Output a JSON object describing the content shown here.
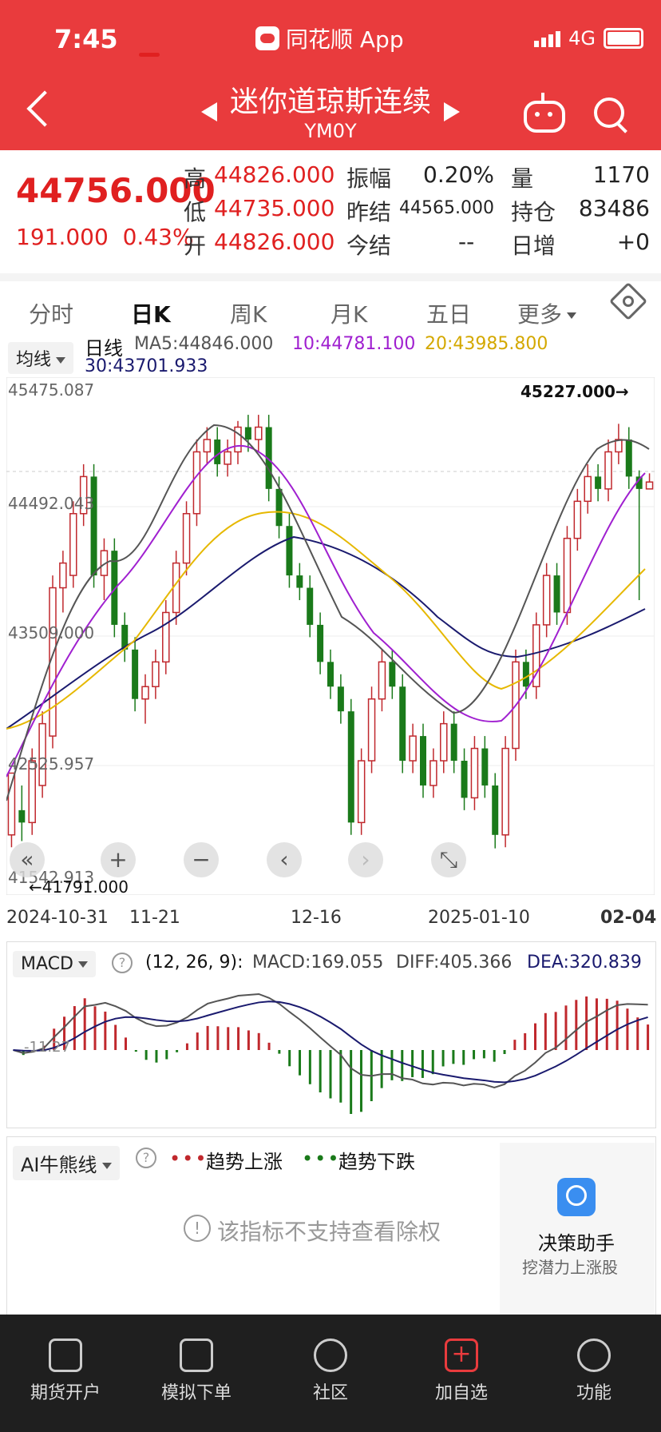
{
  "status": {
    "time": "7:45",
    "app": "同花顺 App",
    "network": "4G"
  },
  "header": {
    "title": "迷你道琼斯连续",
    "symbol": "YM0Y"
  },
  "quote": {
    "price": "44756.000",
    "change": "191.000",
    "change_pct": "0.43%",
    "high_label": "高",
    "high": "44826.000",
    "low_label": "低",
    "low": "44735.000",
    "open_label": "开",
    "open": "44826.000",
    "amp_label": "振幅",
    "amp": "0.20%",
    "prev_label": "昨结",
    "prev": "44565.000",
    "today_label": "今结",
    "today": "--",
    "vol_label": "量",
    "vol": "1170",
    "oi_label": "持仓",
    "oi": "83486",
    "daily_label": "日增",
    "daily": "+0"
  },
  "tabs": [
    "分时",
    "日K",
    "周K",
    "月K",
    "五日",
    "更多"
  ],
  "legend": {
    "select": "均线",
    "period": "日线",
    "ma5": "MA5:44846.000",
    "ma10": "10:44781.100",
    "ma20": "20:43985.800",
    "ma30": "30:43701.933",
    "colors": {
      "ma5": "#555555",
      "ma10": "#a020d0",
      "ma20": "#e6b800",
      "ma30": "#1a1a6e",
      "up": "#c0282d",
      "down": "#1a7a1a"
    }
  },
  "price_axis": [
    "45475.087",
    "44492.043",
    "43509.000",
    "42525.957",
    "41542.913"
  ],
  "annotations": {
    "max": "45227.000→",
    "min": "←41791.000"
  },
  "dates": [
    "2024-10-31",
    "11-21",
    "12-16",
    "2025-01-10",
    "02-04"
  ],
  "macd": {
    "select": "MACD",
    "params": "(12, 26, 9):",
    "macd": "MACD:169.055",
    "diff": "DIFF:405.366",
    "dea": "DEA:320.839",
    "axis_label": "-11.27"
  },
  "ai": {
    "select": "AI牛熊线",
    "up": "趋势上涨",
    "down": "趋势下跌",
    "notice": "该指标不支持查看除权",
    "helper_title": "决策助手",
    "helper_sub": "挖潜力上涨股"
  },
  "nav": [
    "期货开户",
    "模拟下单",
    "社区",
    "加自选",
    "功能"
  ],
  "chart_data": {
    "type": "candlestick",
    "ylim": [
      41542.913,
      45475.087
    ],
    "candles": [
      [
        41900,
        42400,
        41800,
        42100
      ],
      [
        42100,
        42000,
        41850,
        42300
      ],
      [
        42000,
        42500,
        41900,
        42600
      ],
      [
        42300,
        42800,
        42200,
        42900
      ],
      [
        42700,
        43900,
        42600,
        44000
      ],
      [
        43900,
        44100,
        43700,
        44200
      ],
      [
        44000,
        44500,
        43900,
        44600
      ],
      [
        44500,
        44800,
        44400,
        44900
      ],
      [
        44800,
        44000,
        43900,
        44900
      ],
      [
        44000,
        44200,
        43800,
        44300
      ],
      [
        44200,
        43600,
        43500,
        44300
      ],
      [
        43600,
        43400,
        43300,
        43700
      ],
      [
        43400,
        43000,
        42900,
        43500
      ],
      [
        43000,
        43100,
        42800,
        43200
      ],
      [
        43100,
        43300,
        43000,
        43400
      ],
      [
        43300,
        43700,
        43200,
        43800
      ],
      [
        43700,
        44100,
        43600,
        44200
      ],
      [
        44100,
        44500,
        44000,
        44600
      ],
      [
        44500,
        45000,
        44400,
        45100
      ],
      [
        45000,
        45100,
        44900,
        45200
      ],
      [
        45100,
        44900,
        44800,
        45200
      ],
      [
        44900,
        45000,
        44800,
        45100
      ],
      [
        45000,
        45200,
        44900,
        45250
      ],
      [
        45200,
        45100,
        45000,
        45300
      ],
      [
        45100,
        45200,
        45000,
        45300
      ],
      [
        45200,
        44700,
        44600,
        45300
      ],
      [
        44700,
        44400,
        44300,
        44800
      ],
      [
        44400,
        44000,
        43900,
        44500
      ],
      [
        44000,
        43900,
        43800,
        44100
      ],
      [
        43900,
        43600,
        43500,
        44000
      ],
      [
        43600,
        43300,
        43200,
        43700
      ],
      [
        43300,
        43100,
        43000,
        43400
      ],
      [
        43100,
        42900,
        42800,
        43200
      ],
      [
        42900,
        42000,
        41900,
        43000
      ],
      [
        42000,
        42500,
        41900,
        42600
      ],
      [
        42500,
        43000,
        42400,
        43100
      ],
      [
        43000,
        43300,
        42900,
        43400
      ],
      [
        43300,
        43100,
        43000,
        43400
      ],
      [
        43100,
        42500,
        42400,
        43200
      ],
      [
        42500,
        42700,
        42400,
        42800
      ],
      [
        42700,
        42300,
        42200,
        42800
      ],
      [
        42300,
        42500,
        42200,
        42600
      ],
      [
        42500,
        42800,
        42400,
        42900
      ],
      [
        42800,
        42500,
        42400,
        42900
      ],
      [
        42500,
        42200,
        42100,
        42600
      ],
      [
        42200,
        42600,
        42100,
        42700
      ],
      [
        42600,
        42300,
        42200,
        42700
      ],
      [
        42300,
        41900,
        41791,
        42400
      ],
      [
        41900,
        42600,
        41800,
        42700
      ],
      [
        42600,
        43300,
        42500,
        43400
      ],
      [
        43300,
        43100,
        43000,
        43400
      ],
      [
        43100,
        43600,
        43000,
        43700
      ],
      [
        43600,
        44000,
        43500,
        44100
      ],
      [
        44000,
        43700,
        43600,
        44100
      ],
      [
        43700,
        44300,
        43600,
        44400
      ],
      [
        44300,
        44600,
        44200,
        44700
      ],
      [
        44600,
        44800,
        44500,
        44900
      ],
      [
        44800,
        44700,
        44600,
        44900
      ],
      [
        44700,
        45000,
        44600,
        45100
      ],
      [
        45000,
        45100,
        44900,
        45227
      ],
      [
        45100,
        44800,
        44700,
        45200
      ],
      [
        44800,
        44700,
        43800,
        44850
      ],
      [
        44700,
        44756,
        44735,
        44826
      ]
    ]
  }
}
